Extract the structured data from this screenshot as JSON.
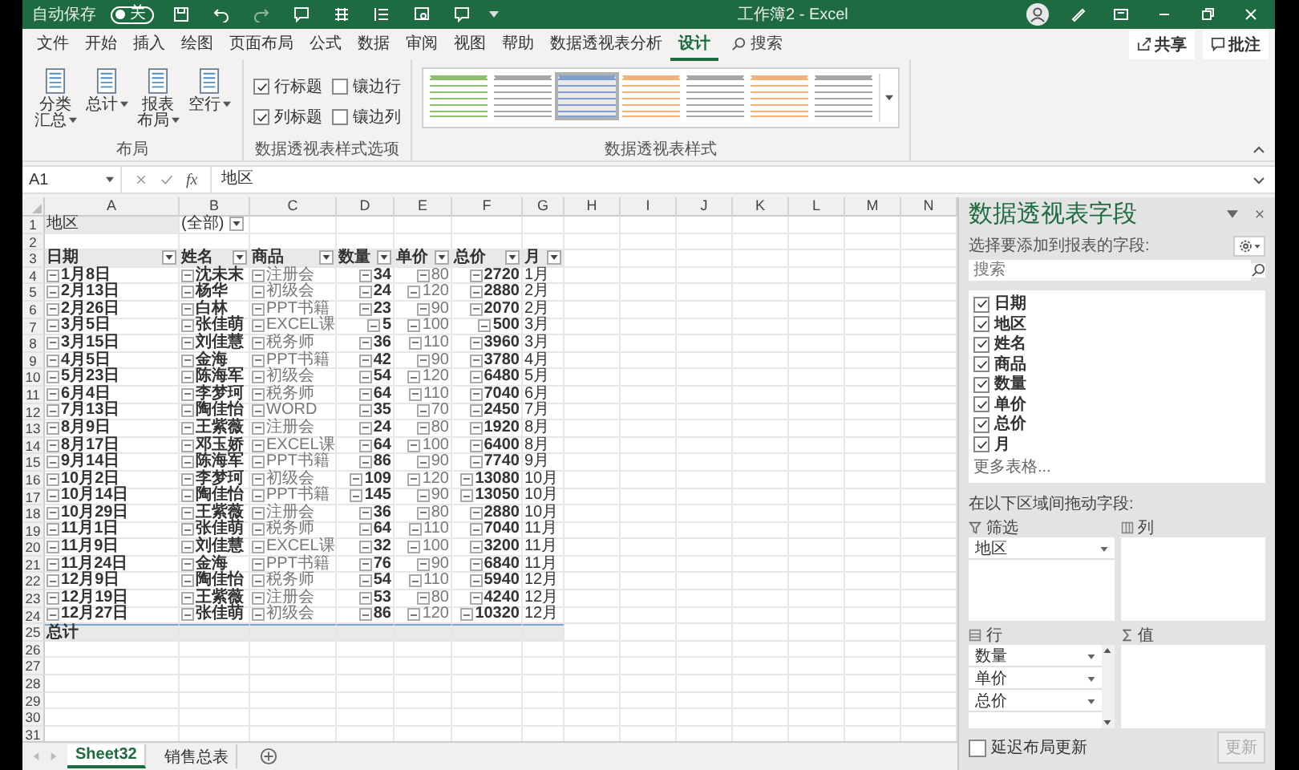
{
  "titlebar": {
    "autosave_label": "自动保存",
    "autosave": {
      "state": "关",
      "on": false
    },
    "title": "工作簿2 - Excel"
  },
  "ribbon_tabs": [
    {
      "label": "文件",
      "selected": false
    },
    {
      "label": "开始",
      "selected": false
    },
    {
      "label": "插入",
      "selected": false
    },
    {
      "label": "绘图",
      "selected": false
    },
    {
      "label": "页面布局",
      "selected": false
    },
    {
      "label": "公式",
      "selected": false
    },
    {
      "label": "数据",
      "selected": false
    },
    {
      "label": "审阅",
      "selected": false
    },
    {
      "label": "视图",
      "selected": false
    },
    {
      "label": "帮助",
      "selected": false
    },
    {
      "label": "数据透视表分析",
      "selected": false
    },
    {
      "label": "设计",
      "selected": true
    }
  ],
  "search": {
    "placeholder": "搜索"
  },
  "share_button": "共享",
  "comments_button": "批注",
  "layout_group": {
    "label": "布局",
    "buttons": [
      "分类汇总",
      "总计",
      "报表布局",
      "空行"
    ]
  },
  "style_options": {
    "label": "数据透视表样式选项",
    "options": [
      {
        "label": "行标题",
        "checked": true
      },
      {
        "label": "镶边行",
        "checked": false
      },
      {
        "label": "列标题",
        "checked": true
      },
      {
        "label": "镶边列",
        "checked": false
      }
    ]
  },
  "styles_gallery": {
    "label": "数据透视表样式",
    "styles": [
      {
        "color": "#8cbf6a",
        "selected": false
      },
      {
        "color": "#a6a6a6",
        "selected": false
      },
      {
        "color": "#7f9fcf",
        "selected": true
      },
      {
        "color": "#f2b27a",
        "selected": false
      },
      {
        "color": "#a6a6a6",
        "selected": false
      },
      {
        "color": "#f2b27a",
        "selected": false
      },
      {
        "color": "#a6a6a6",
        "selected": false
      }
    ]
  },
  "formula_bar": {
    "name_box": "A1",
    "function_label": "fx",
    "formula": "地区"
  },
  "sheet": {
    "columns": [
      "A",
      "B",
      "C",
      "D",
      "E",
      "F",
      "G",
      "H",
      "I",
      "J",
      "K",
      "L",
      "M",
      "N"
    ],
    "row_numbers": [
      "1",
      "2",
      "3",
      "4",
      "5",
      "6",
      "7",
      "8",
      "9",
      "10",
      "11",
      "12",
      "13",
      "14",
      "15",
      "16",
      "17",
      "18",
      "19",
      "20",
      "21",
      "22",
      "23",
      "24",
      "25",
      "26",
      "27",
      "28",
      "29",
      "30",
      "31"
    ],
    "filter": {
      "field": "地区",
      "value": "(全部)"
    },
    "headers": [
      "日期",
      "姓名",
      "商品",
      "数量",
      "单价",
      "总价",
      "月"
    ],
    "rows": [
      {
        "date": "1月8日",
        "name": "沈未末",
        "product": "注册会",
        "quantity": "34",
        "unit_price": "80",
        "total": "2720",
        "month": "1月"
      },
      {
        "date": "2月13日",
        "name": "杨华",
        "product": "初级会",
        "quantity": "24",
        "unit_price": "120",
        "total": "2880",
        "month": "2月"
      },
      {
        "date": "2月26日",
        "name": "白林",
        "product": "PPT书籍",
        "quantity": "23",
        "unit_price": "90",
        "total": "2070",
        "month": "2月"
      },
      {
        "date": "3月5日",
        "name": "张佳萌",
        "product": "EXCEL课",
        "quantity": "5",
        "unit_price": "100",
        "total": "500",
        "month": "3月"
      },
      {
        "date": "3月15日",
        "name": "刘佳慧",
        "product": "税务师",
        "quantity": "36",
        "unit_price": "110",
        "total": "3960",
        "month": "3月"
      },
      {
        "date": "4月5日",
        "name": "金海",
        "product": "PPT书籍",
        "quantity": "42",
        "unit_price": "90",
        "total": "3780",
        "month": "4月"
      },
      {
        "date": "5月23日",
        "name": "陈海军",
        "product": "初级会",
        "quantity": "54",
        "unit_price": "120",
        "total": "6480",
        "month": "5月"
      },
      {
        "date": "6月4日",
        "name": "李梦珂",
        "product": "税务师",
        "quantity": "64",
        "unit_price": "110",
        "total": "7040",
        "month": "6月"
      },
      {
        "date": "7月13日",
        "name": "陶佳怡",
        "product": "WORD",
        "quantity": "35",
        "unit_price": "70",
        "total": "2450",
        "month": "7月"
      },
      {
        "date": "8月9日",
        "name": "王紫薇",
        "product": "注册会",
        "quantity": "24",
        "unit_price": "80",
        "total": "1920",
        "month": "8月"
      },
      {
        "date": "8月17日",
        "name": "邓玉娇",
        "product": "EXCEL课",
        "quantity": "64",
        "unit_price": "100",
        "total": "6400",
        "month": "8月"
      },
      {
        "date": "9月14日",
        "name": "陈海军",
        "product": "PPT书籍",
        "quantity": "86",
        "unit_price": "90",
        "total": "7740",
        "month": "9月"
      },
      {
        "date": "10月2日",
        "name": "李梦珂",
        "product": "初级会",
        "quantity": "109",
        "unit_price": "120",
        "total": "13080",
        "month": "10月"
      },
      {
        "date": "10月14日",
        "name": "陶佳怡",
        "product": "PPT书籍",
        "quantity": "145",
        "unit_price": "90",
        "total": "13050",
        "month": "10月"
      },
      {
        "date": "10月29日",
        "name": "王紫薇",
        "product": "注册会",
        "quantity": "36",
        "unit_price": "80",
        "total": "2880",
        "month": "10月"
      },
      {
        "date": "11月1日",
        "name": "张佳萌",
        "product": "税务师",
        "quantity": "64",
        "unit_price": "110",
        "total": "7040",
        "month": "11月"
      },
      {
        "date": "11月9日",
        "name": "刘佳慧",
        "product": "EXCEL课",
        "quantity": "32",
        "unit_price": "100",
        "total": "3200",
        "month": "11月"
      },
      {
        "date": "11月24日",
        "name": "金海",
        "product": "PPT书籍",
        "quantity": "76",
        "unit_price": "90",
        "total": "6840",
        "month": "11月"
      },
      {
        "date": "12月9日",
        "name": "陶佳怡",
        "product": "税务师",
        "quantity": "54",
        "unit_price": "110",
        "total": "5940",
        "month": "12月"
      },
      {
        "date": "12月19日",
        "name": "王紫薇",
        "product": "注册会",
        "quantity": "53",
        "unit_price": "80",
        "total": "4240",
        "month": "12月"
      },
      {
        "date": "12月27日",
        "name": "张佳萌",
        "product": "初级会",
        "quantity": "86",
        "unit_price": "120",
        "total": "10320",
        "month": "12月"
      }
    ],
    "grand_total": "总计"
  },
  "sheet_tabs": [
    {
      "label": "Sheet32",
      "selected": true
    },
    {
      "label": "销售总表",
      "selected": false
    }
  ],
  "field_list": {
    "title": "数据透视表字段",
    "subtitle": "选择要添加到报表的字段:",
    "search_placeholder": "搜索",
    "fields": [
      {
        "label": "日期",
        "checked": true
      },
      {
        "label": "地区",
        "checked": true
      },
      {
        "label": "姓名",
        "checked": true
      },
      {
        "label": "商品",
        "checked": true
      },
      {
        "label": "数量",
        "checked": true
      },
      {
        "label": "单价",
        "checked": true
      },
      {
        "label": "总价",
        "checked": true
      },
      {
        "label": "月",
        "checked": true
      }
    ],
    "more_tables": "更多表格...",
    "drag_label": "在以下区域间拖动字段:",
    "areas": [
      {
        "kind": "filter",
        "label": "筛选",
        "items": [
          "地区"
        ]
      },
      {
        "kind": "columns",
        "label": "列"
      },
      {
        "kind": "rows",
        "label": "行",
        "items": [
          "数量",
          "单价",
          "总价"
        ]
      },
      {
        "kind": "values",
        "label": "值"
      }
    ],
    "defer": {
      "label": "延迟布局更新",
      "checked": false
    },
    "update_button": {
      "label": "更新",
      "disabled": true
    }
  }
}
